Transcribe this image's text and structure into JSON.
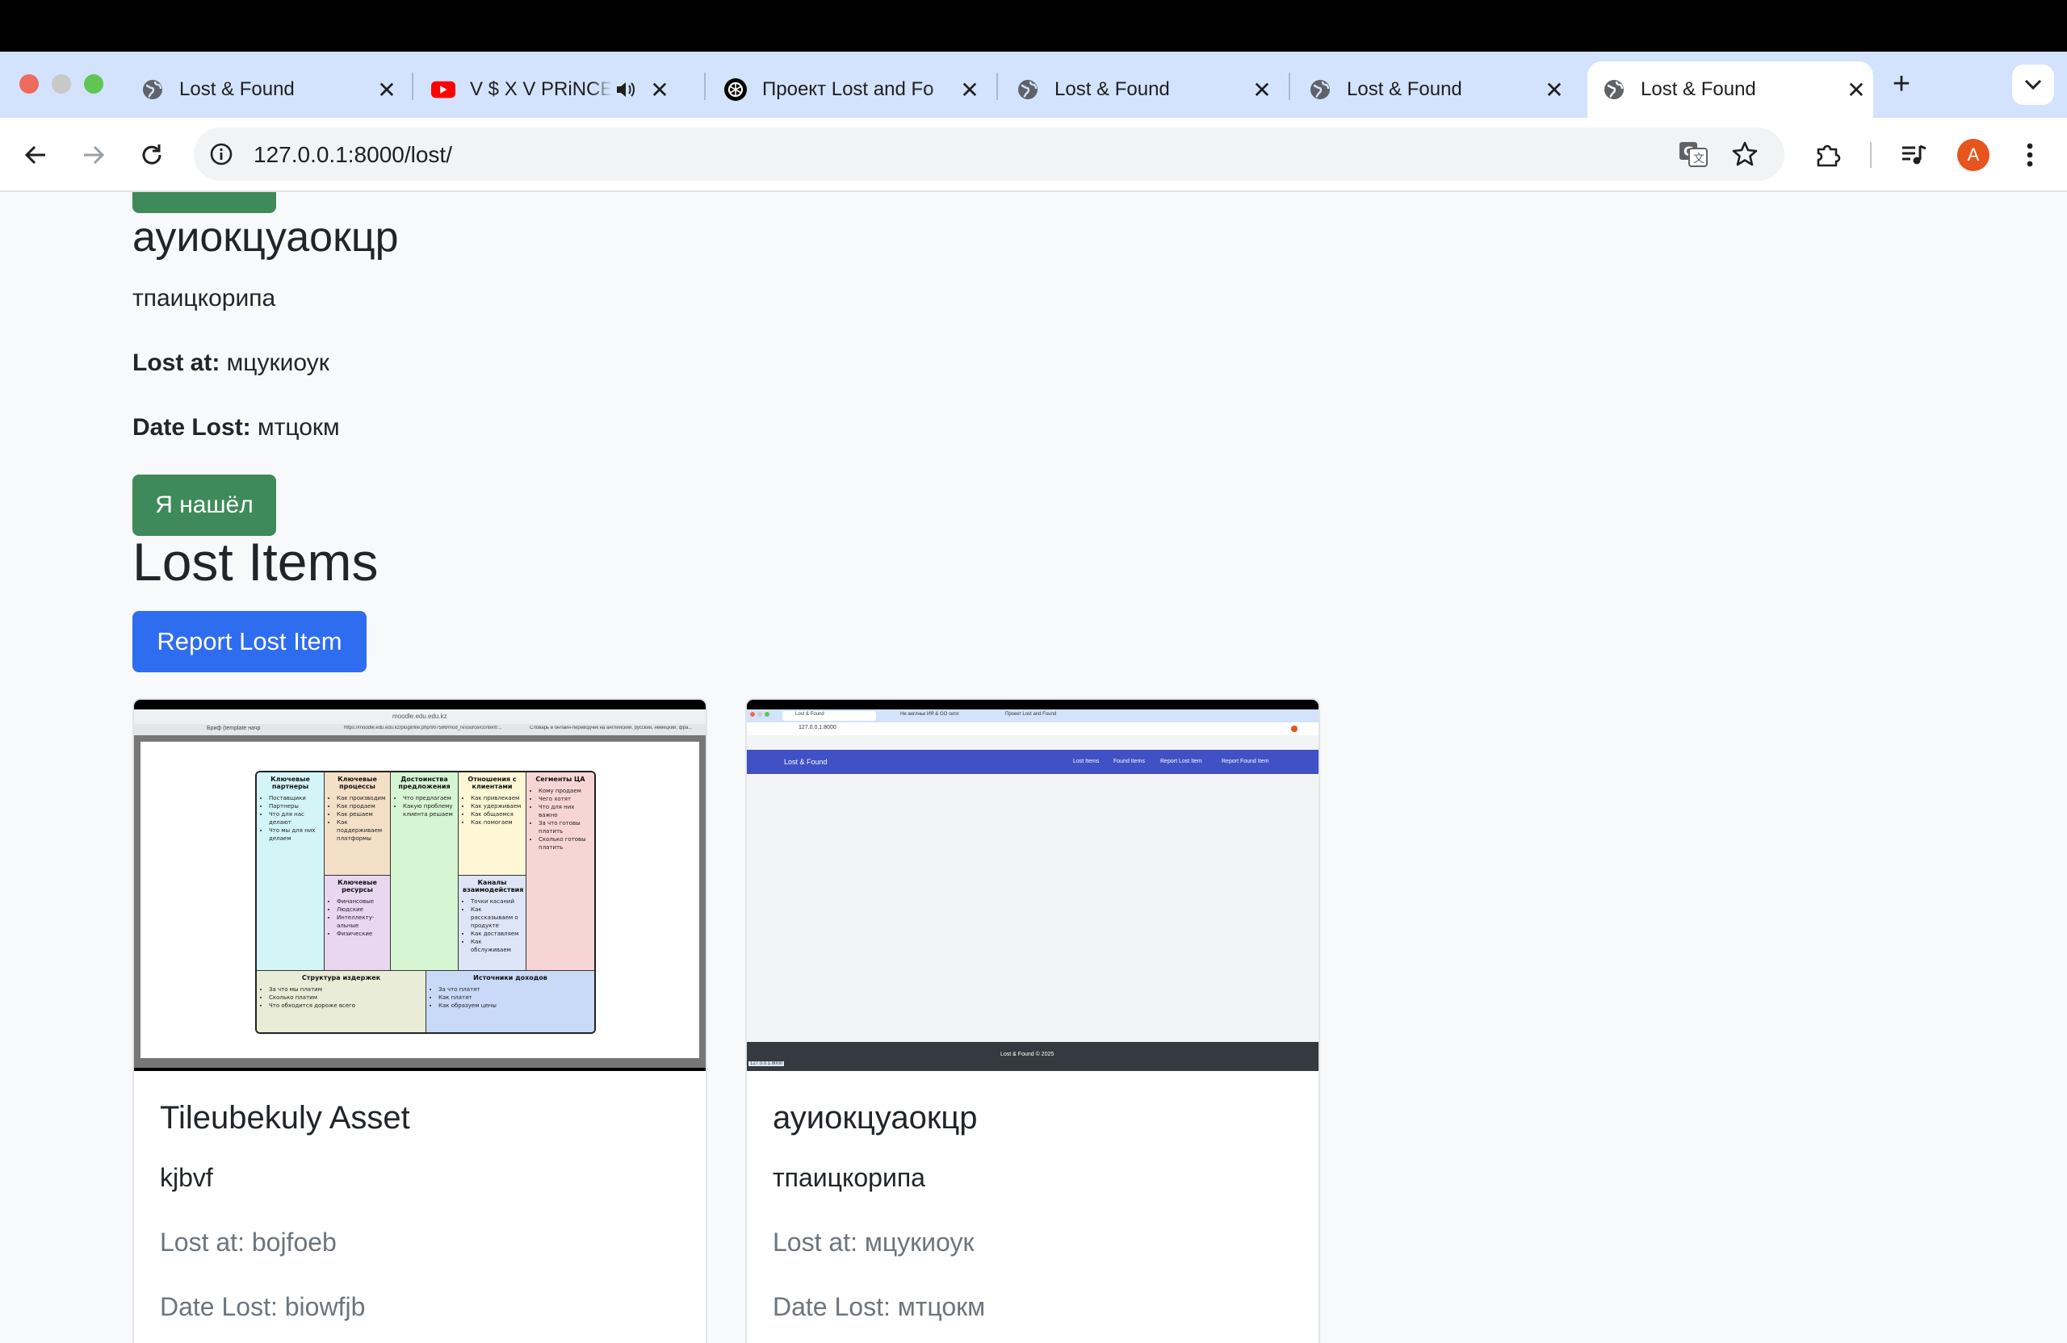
{
  "browser": {
    "tabs": [
      {
        "title": "Lost & Found",
        "icon": "globe-icon",
        "active": false
      },
      {
        "title": "V $ X V PRiNCE",
        "icon": "youtube-icon",
        "active": false,
        "audio": true
      },
      {
        "title": "Проект Lost and Fo",
        "icon": "chatgpt-icon",
        "active": false
      },
      {
        "title": "Lost & Found",
        "icon": "globe-icon",
        "active": false
      },
      {
        "title": "Lost & Found",
        "icon": "globe-icon",
        "active": false
      },
      {
        "title": "Lost & Found",
        "icon": "globe-icon",
        "active": true
      }
    ],
    "url": "127.0.0.1:8000/lost/",
    "profile_initial": "A",
    "colors": {
      "tabstrip": "#d3e3fd",
      "profile": "#e8541e"
    }
  },
  "page": {
    "top_item": {
      "title": "ауиокцуаокцр",
      "description": "тпаицкорипа",
      "lost_at_label": "Lost at:",
      "lost_at_value": "мцукиоук",
      "date_lost_label": "Date Lost:",
      "date_lost_value": "мтцокм",
      "found_button": "Я нашёл"
    },
    "section_title": "Lost Items",
    "report_button": "Report Lost Item",
    "colors": {
      "green_button": "#3f8a5a",
      "blue_button": "#2f6df0"
    },
    "cards": [
      {
        "title": "Tileubekuly Asset",
        "description": "kjbvf",
        "lost_at": "Lost at: bojfoeb",
        "date_lost": "Date Lost: biowfjb",
        "image": {
          "address": "moodle.edu.edu.kz",
          "tab1": "Бриф (template начр",
          "tab2": "https://moodle.edu.edu.kz/pluginfile.php/907586/mod_resource/content/...",
          "tab3": "Словарь в онлайн-переводчик на английский, русский, немецкий, фра...",
          "canvas": {
            "partners": {
              "title": "Ключевые партнеры",
              "items": [
                "Поставщики",
                "Партнеры",
                "Что для нас делают",
                "Что мы для них делаем"
              ]
            },
            "activities": {
              "title": "Ключевые процессы",
              "items": [
                "Как производим",
                "Как продаем",
                "Как решаем",
                "Как поддерживаем платформы"
              ]
            },
            "value": {
              "title": "Достоинства предложения",
              "items": [
                "Что предлагаем",
                "Какую проблему клиента решаем"
              ]
            },
            "relations": {
              "title": "Отношения с клиентами",
              "items": [
                "Как привлекаем",
                "Как удерживаем",
                "Как общаемся",
                "Как помогаем"
              ]
            },
            "segments": {
              "title": "Сегменты ЦА",
              "items": [
                "Кому продаем",
                "Чего хотят",
                "Что для них важно",
                "За что готовы платить",
                "Сколько готовы платить"
              ]
            },
            "resources": {
              "title": "Ключевые ресурсы",
              "items": [
                "Финансовые",
                "Людские",
                "Интеллекту-альные",
                "Физические"
              ]
            },
            "channels": {
              "title": "Каналы взаимодействия",
              "items": [
                "Точки касаний",
                "Как рассказываем о продукте",
                "Как доставляем",
                "Как обслуживаем"
              ]
            },
            "costs": {
              "title": "Структура издержек",
              "items": [
                "За что мы платим",
                "Сколько платим",
                "Что обходится дороже всего"
              ]
            },
            "revenue": {
              "title": "Источники доходов",
              "items": [
                "За что платят",
                "Как платят",
                "Как образуем цены"
              ]
            }
          }
        }
      },
      {
        "title": "ауиокцуаокцр",
        "description": "тпаицкорипа",
        "lost_at": "Lost at: мцукиоук",
        "date_lost": "Date Lost: мтцокм",
        "image": {
          "tab1": "Lost & Found",
          "tab2": "Не англнье ИЯ & GO сити",
          "tab3": "Проект Lost and Found",
          "address": "127.0.0.1:8000",
          "brand": "Lost & Found",
          "nav": [
            "Lost Items",
            "Found Items",
            "Report Lost Item",
            "Report Found Item"
          ],
          "footer": "Lost & Found © 2025",
          "status": "127.0.0.1:8000"
        }
      }
    ]
  }
}
